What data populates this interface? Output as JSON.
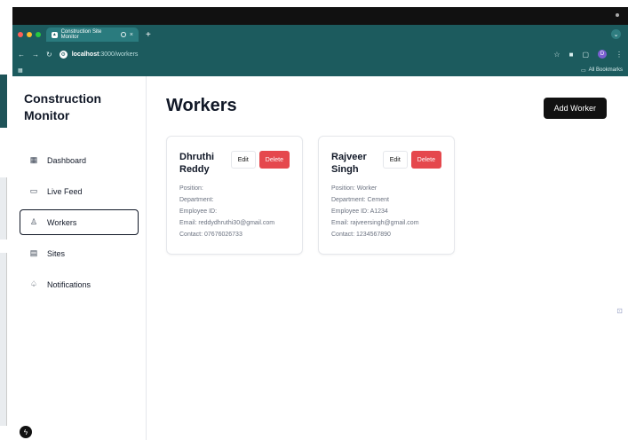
{
  "browser": {
    "tab_title": "Construction Site Monitor",
    "tab_close": "×",
    "new_tab": "+",
    "url_host": "localhost",
    "url_path": ":3000/workers",
    "all_bookmarks": "All Bookmarks",
    "profile_initial": "D"
  },
  "sidebar": {
    "brand": "Construction Monitor",
    "items": [
      {
        "label": "Dashboard",
        "icon": "dashboard-icon"
      },
      {
        "label": "Live Feed",
        "icon": "camera-icon"
      },
      {
        "label": "Workers",
        "icon": "users-icon",
        "active": true
      },
      {
        "label": "Sites",
        "icon": "building-icon"
      },
      {
        "label": "Notifications",
        "icon": "bell-icon"
      }
    ]
  },
  "main": {
    "title": "Workers",
    "add_button": "Add Worker",
    "edit_label": "Edit",
    "delete_label": "Delete",
    "workers": [
      {
        "name": "Dhruthi Reddy",
        "position": "Position:",
        "department": "Department:",
        "employee_id": "Employee ID:",
        "email": "Email: reddydhruthi30@gmail.com",
        "contact": "Contact: 07676026733"
      },
      {
        "name": "Rajveer Singh",
        "position": "Position: Worker",
        "department": "Department: Cement",
        "employee_id": "Employee ID: A1234",
        "email": "Email: rajveersingh@gmail.com",
        "contact": "Contact: 1234567890"
      }
    ]
  },
  "colors": {
    "browser_chrome": "#1c5b5e",
    "delete": "#e5484d",
    "primary": "#111111"
  }
}
